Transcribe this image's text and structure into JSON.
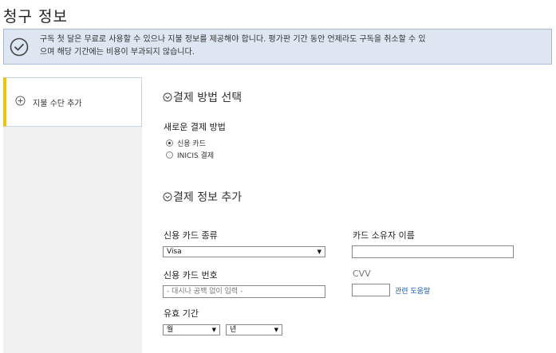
{
  "page": {
    "title": "청구 정보"
  },
  "banner": {
    "icon": "checkmark-circle-icon",
    "line1": "구독 첫 달은 무료로 사용할 수 있으나 지불 정보를 제공해야 합니다. 평가판 기간 동안 언제라도 구독을 취소할 수 있",
    "line2": "으며 해당 기간에는 비용이 부과되지 않습니다."
  },
  "sidebar": {
    "items": [
      {
        "icon": "plus-circle-icon",
        "label": "지불 수단 추가"
      }
    ]
  },
  "payment_method": {
    "heading": "결제 방법 선택",
    "subheading": "새로운 결제 방법",
    "options": [
      {
        "label": "신용 카드",
        "checked": true
      },
      {
        "label": "INICIS 결제",
        "checked": false
      }
    ]
  },
  "payment_info": {
    "heading": "결제 정보 추가",
    "card_type_label": "신용 카드 종류",
    "card_type_value": "Visa",
    "card_number_label": "신용 카드 번호",
    "card_number_placeholder": "- 대시나 공백 없이 입력 -",
    "expiry_label": "유효 기간",
    "expiry_month_value": "월",
    "expiry_year_value": "년",
    "cardholder_label": "카드 소유자 이름",
    "cardholder_value": "",
    "cvv_label": "CVV",
    "cvv_value": "",
    "help_link": "관련 도움말"
  },
  "colors": {
    "banner_bg": "#dde6f1",
    "banner_border": "#a9bbd3",
    "sidebar_accent": "#f2c200",
    "link": "#1a5fb4"
  }
}
